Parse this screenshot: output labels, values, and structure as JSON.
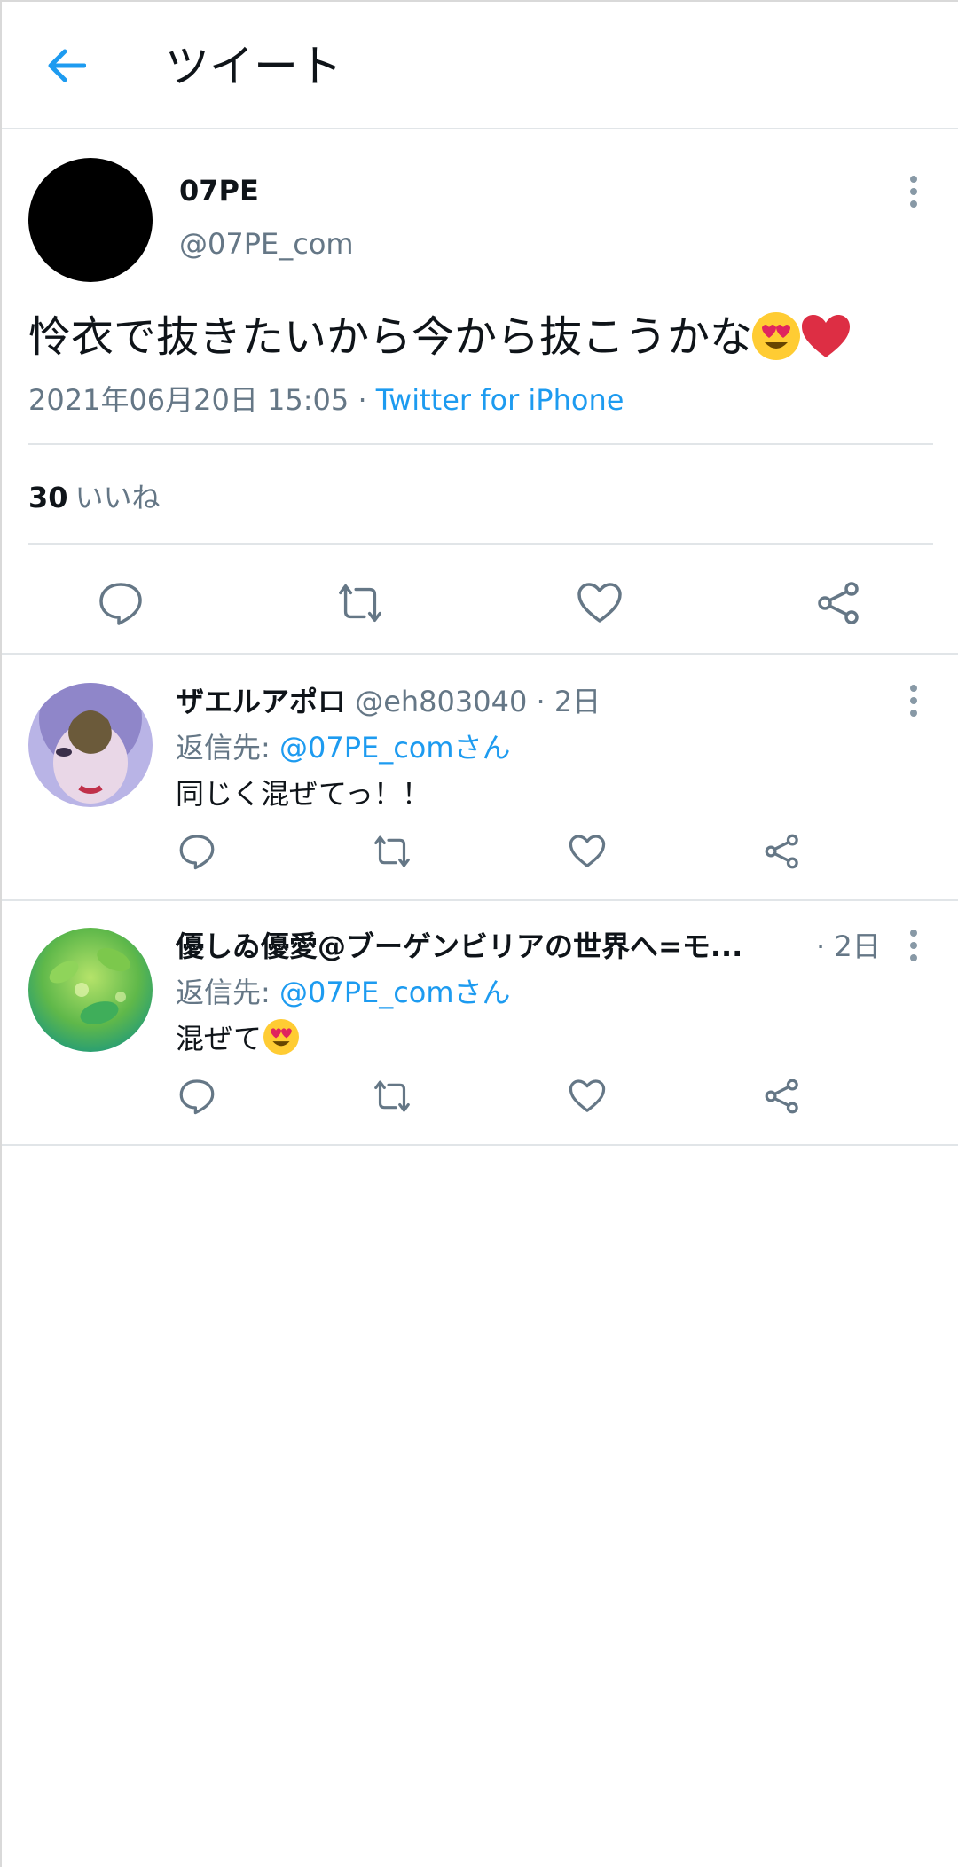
{
  "header": {
    "title": "ツイート"
  },
  "main_tweet": {
    "name": "07PE",
    "handle": "@07PE_com",
    "text": "怜衣で抜きたいから今から抜こうかな",
    "emoji": [
      "smiling-face-with-heart-eyes",
      "red-heart"
    ],
    "timestamp": "2021年06月20日 15:05 · ",
    "source": "Twitter for iPhone",
    "likes_count": "30",
    "likes_label": "いいね"
  },
  "replies": [
    {
      "name": "ザエルアポロ",
      "handle": "@eh803040",
      "time": " · 2日",
      "reply_to_label": "返信先: ",
      "reply_to_mention": "@07PE_comさん",
      "text": "同じく混ぜてっ！！"
    },
    {
      "name": "優しゐ優愛@ブーゲンビリアの世界へ=モ...",
      "time": "· 2日",
      "reply_to_label": "返信先: ",
      "reply_to_mention": "@07PE_comさん",
      "text": "混ぜて",
      "emoji": [
        "smiling-face-with-heart-eyes"
      ]
    }
  ],
  "colors": {
    "accent": "#1d9bf0",
    "secondary_text": "#657786",
    "divider": "#e1e5e8"
  }
}
